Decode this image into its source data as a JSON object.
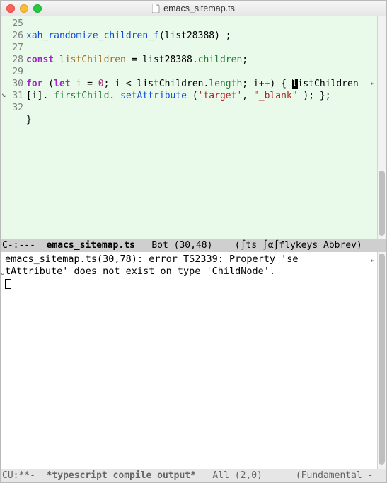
{
  "title": "emacs_sitemap.ts",
  "gutter_lines": [
    "25",
    "26",
    "27",
    "28",
    "29",
    "30",
    "",
    "31",
    "32"
  ],
  "code": {
    "l26_fn": "xah_randomize_children_f",
    "l26_arg": "list28388",
    "l28_kw": "const",
    "l28_var": "listChildren",
    "l28_expr_a": "list28388",
    "l28_prop": "children",
    "l30_for": "for",
    "l30_let": "let",
    "l30_i": "i",
    "l30_eq": " = ",
    "l30_zero": "0",
    "l30_semi1": "; i < listChildren.",
    "l30_len": "length",
    "l30_semi2": "; i++) { ",
    "l30_cur": "l",
    "l30_rest": "istChildren",
    "l30w_a": "[i]. ",
    "l30w_fc": "firstChild",
    "l30w_dot": ". ",
    "l30w_sa": "setAttribute",
    "l30w_paren": " (",
    "l30w_s1": "'target'",
    "l30w_comma": ", ",
    "l30w_s2": "\"_blank\"",
    "l30w_end": " ); };",
    "l32": "}"
  },
  "modeline_top": {
    "left": "C-:---  ",
    "buffer": "emacs_sitemap.ts",
    "pos": "   Bot (30,48)    ",
    "modes": "(∫ts ∫α∫flykeys Abbrev)"
  },
  "output": {
    "loc": "emacs_sitemap.ts(30,78)",
    "msg_a": ": error TS2339: Property 'se",
    "msg_b": "tAttribute' does not exist on type 'ChildNode'."
  },
  "modeline_bot": {
    "left": "CU:**-  ",
    "buffer": "*typescript compile output*",
    "pos": "   All (2,0)      ",
    "modes": "(Fundamental -"
  }
}
